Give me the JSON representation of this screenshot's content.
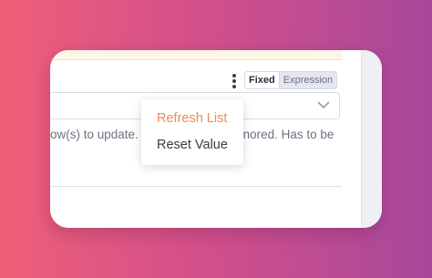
{
  "colors": {
    "accent": "#ef8a5a",
    "text": "#3a3b44",
    "muted": "#6b7280"
  },
  "param_header": {
    "options_icon": "kebab-menu-icon",
    "mode_toggle": {
      "fixed_label": "Fixed",
      "expression_label": "Expression",
      "selected": "Fixed"
    }
  },
  "select_field": {
    "value": "",
    "icon": "chevron-down-icon"
  },
  "hint_text": "ow(s) to update. If not set, will be ignored. Has to be",
  "options_menu": {
    "items": [
      {
        "label": "Refresh List"
      },
      {
        "label": "Reset Value"
      }
    ]
  }
}
